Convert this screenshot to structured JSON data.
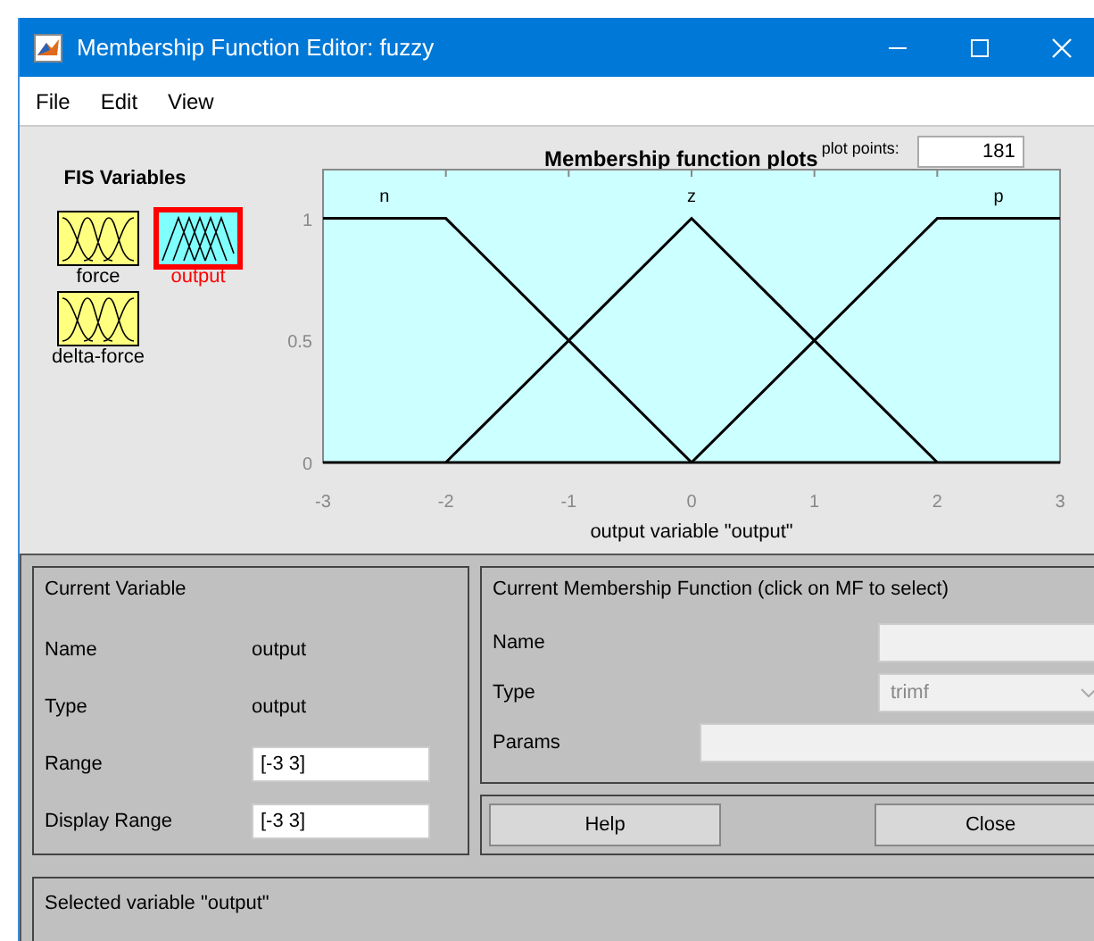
{
  "window": {
    "title": "Membership Function Editor: fuzzy"
  },
  "menu": [
    "File",
    "Edit",
    "View"
  ],
  "fis_variables": {
    "title": "FIS Variables",
    "items": [
      {
        "label": "force",
        "kind": "input",
        "selected": false
      },
      {
        "label": "output",
        "kind": "output",
        "selected": true
      },
      {
        "label": "delta-force",
        "kind": "input",
        "selected": false
      }
    ]
  },
  "plot": {
    "plot_points_label": "plot points:",
    "plot_points": "181",
    "chart_data": {
      "type": "line",
      "title": "Membership function plots",
      "xlabel": "output variable \"output\"",
      "x": [
        -3,
        -2,
        -1,
        0,
        1,
        2,
        3
      ],
      "series": [
        {
          "name": "n",
          "color": "#000000",
          "values": [
            1,
            1,
            0.5,
            0,
            null,
            null,
            null
          ]
        },
        {
          "name": "z",
          "color": "#000000",
          "values": [
            null,
            0,
            0.5,
            1,
            0.5,
            0,
            null
          ]
        },
        {
          "name": "p",
          "color": "#000000",
          "values": [
            null,
            null,
            null,
            0,
            0.5,
            1,
            1
          ]
        }
      ],
      "xlim": [
        -3,
        3
      ],
      "ylim": [
        0,
        1.2
      ],
      "xticks": [
        -3,
        -2,
        -1,
        0,
        1,
        2,
        3
      ],
      "yticks": [
        0,
        0.5,
        1
      ]
    }
  },
  "current_variable": {
    "title": "Current Variable",
    "fields": [
      {
        "label": "Name",
        "kind": "text",
        "value": "output"
      },
      {
        "label": "Type",
        "kind": "text",
        "value": "output"
      },
      {
        "label": "Range",
        "kind": "input",
        "value": "[-3 3]"
      },
      {
        "label": "Display Range",
        "kind": "input",
        "value": "[-3 3]"
      }
    ]
  },
  "current_mf": {
    "title": "Current Membership Function (click on MF to select)",
    "fields": [
      {
        "label": "Name",
        "kind": "input",
        "disabled": true
      },
      {
        "label": "Type",
        "kind": "select",
        "value": "trimf",
        "disabled": true
      },
      {
        "label": "Params",
        "kind": "wide",
        "disabled": true
      }
    ]
  },
  "buttons": [
    "Help",
    "Close"
  ],
  "status": "Selected variable \"output\""
}
